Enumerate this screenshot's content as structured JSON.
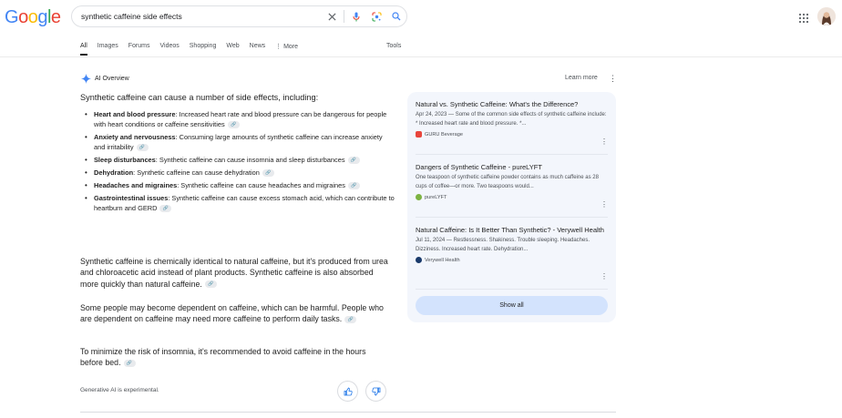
{
  "logo": {
    "letters": [
      "G",
      "o",
      "o",
      "g",
      "l",
      "e"
    ],
    "colors": [
      "#4285F4",
      "#EA4335",
      "#FBBC05",
      "#4285F4",
      "#34A853",
      "#EA4335"
    ]
  },
  "search": {
    "query": "synthetic caffeine side effects"
  },
  "tabs": [
    {
      "label": "All",
      "active": true
    },
    {
      "label": "Images"
    },
    {
      "label": "Forums"
    },
    {
      "label": "Videos"
    },
    {
      "label": "Shopping"
    },
    {
      "label": "Web"
    },
    {
      "label": "News"
    },
    {
      "label": "⋮ More"
    }
  ],
  "tools_label": "Tools",
  "ai_overview": {
    "header": "AI Overview",
    "learn_more": "Learn more",
    "intro": "Synthetic caffeine can cause a number of side effects, including:",
    "bullets": [
      {
        "title": "Heart and blood pressure",
        "text": ": Increased heart rate and blood pressure can be dangerous for people with heart conditions or caffeine sensitivities"
      },
      {
        "title": "Anxiety and nervousness",
        "text": ": Consuming large amounts of synthetic caffeine can increase anxiety and irritability"
      },
      {
        "title": "Sleep disturbances",
        "text": ": Synthetic caffeine can cause insomnia and sleep disturbances"
      },
      {
        "title": "Dehydration",
        "text": ": Synthetic caffeine can cause dehydration"
      },
      {
        "title": "Headaches and migraines",
        "text": ": Synthetic caffeine can cause headaches and migraines"
      },
      {
        "title": "Gastrointestinal issues",
        "text": ": Synthetic caffeine can cause excess stomach acid, which can contribute to heartburn and GERD"
      }
    ],
    "paragraphs": [
      "Synthetic caffeine is chemically identical to natural caffeine, but it's produced from urea and chloroacetic acid instead of plant products. Synthetic caffeine is also absorbed more quickly than natural caffeine.",
      "Some people may become dependent on caffeine, which can be harmful. People who are dependent on caffeine may need more caffeine to perform daily tasks.",
      "To minimize the risk of insomnia, it's recommended to avoid caffeine in the hours before bed."
    ],
    "footer_note": "Generative AI is experimental."
  },
  "sources": {
    "cards": [
      {
        "title": "Natural vs. Synthetic Caffeine: What's the Difference?",
        "snippet": "Apr 24, 2023 — Some of the common side effects of synthetic caffeine include: * Increased heart rate and blood pressure. *...",
        "source": "GURU Beverage",
        "fav_color": "#e8453c"
      },
      {
        "title": "Dangers of Synthetic Caffeine - pureLYFT",
        "snippet": "One teaspoon of synthetic caffeine powder contains as much caffeine as 28 cups of coffee—or more. Two teaspoons would...",
        "source": "pureLYFT",
        "fav_color": "#7cb342"
      },
      {
        "title": "Natural Caffeine: Is It Better Than Synthetic? - Verywell Health",
        "snippet": "Jul 11, 2024 — Restlessness. Shakiness. Trouble sleeping. Headaches. Dizziness. Increased heart rate. Dehydration...",
        "source": "Verywell Health",
        "fav_color": "#1a3a6b"
      }
    ],
    "show_all": "Show all"
  }
}
